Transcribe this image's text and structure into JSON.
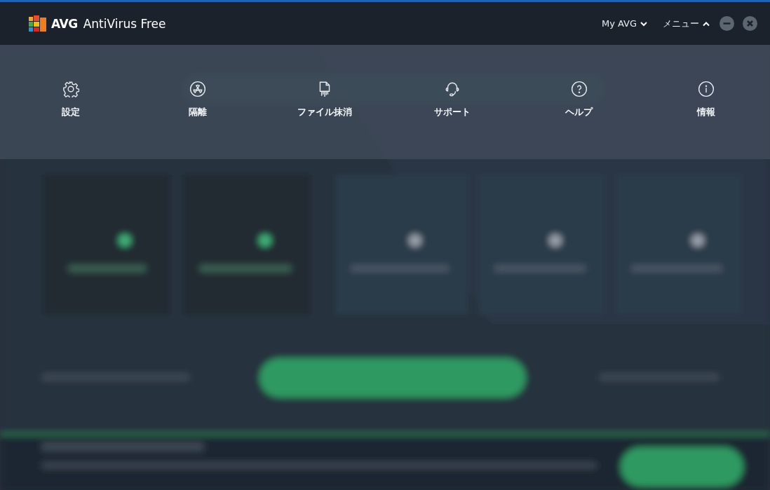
{
  "window": {
    "brand": "AVG",
    "title": "AntiVirus Free"
  },
  "header_menus": [
    {
      "label": "My AVG",
      "expanded": false
    },
    {
      "label": "メニュー",
      "expanded": true
    }
  ],
  "menu_items": [
    {
      "label": "設定",
      "kind": "gear"
    },
    {
      "label": "隔離",
      "kind": "quarantine"
    },
    {
      "label": "ファイル抹消",
      "kind": "shredder"
    },
    {
      "label": "サポート",
      "kind": "headset"
    },
    {
      "label": "ヘルプ",
      "kind": "help"
    },
    {
      "label": "情報",
      "kind": "info"
    }
  ]
}
